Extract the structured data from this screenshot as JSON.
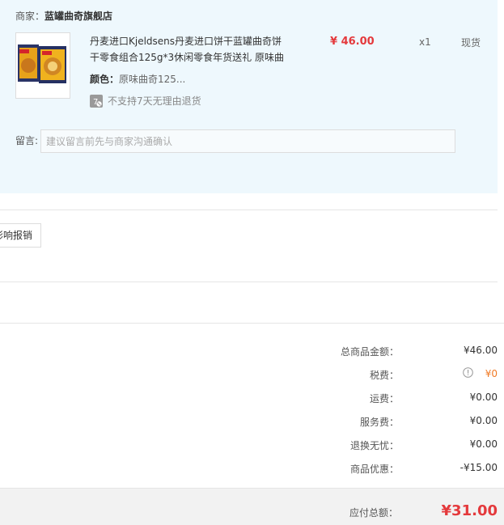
{
  "shop": {
    "label": "商家：",
    "name": "蓝罐曲奇旗舰店"
  },
  "product": {
    "title": "丹麦进口Kjeldsens丹麦进口饼干蓝罐曲奇饼干零食组合125g*3休闲零食年货送礼 原味曲",
    "spec_key": "颜色：",
    "spec_value": "原味曲奇125...",
    "no_return_text": "不支持7天无理由退货",
    "price": "¥ 46.00",
    "qty": "x1",
    "stock": "现货",
    "image_icon": "cookie-tin-product-image"
  },
  "memo": {
    "label": "留言:",
    "placeholder": "建议留言前先与商家沟通确认"
  },
  "invoice_button": "影响报销",
  "summary": [
    {
      "label": "总商品金额：",
      "value": "¥46.00"
    },
    {
      "label": "税费：",
      "value": "¥0",
      "icon": "info-circle-icon"
    },
    {
      "label": "运费：",
      "value": "¥0.00"
    },
    {
      "label": "服务费：",
      "value": "¥0.00"
    },
    {
      "label": "退换无忧：",
      "value": "¥0.00"
    },
    {
      "label": "商品优惠：",
      "value": "-¥15.00"
    }
  ],
  "total": {
    "label": "应付总额：",
    "value": "¥31.00"
  },
  "colors": {
    "accent": "#e4393c",
    "panel": "#eef8fd",
    "tax": "#f07a25"
  }
}
